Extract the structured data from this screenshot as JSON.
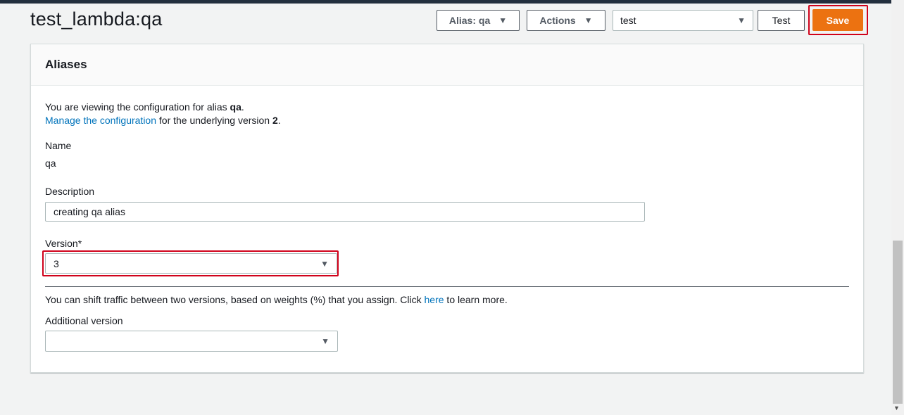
{
  "page": {
    "title": "test_lambda:qa"
  },
  "toolbar": {
    "alias_label": "Alias: qa",
    "actions_label": "Actions",
    "test_event_value": "test",
    "test_label": "Test",
    "save_label": "Save"
  },
  "aliases": {
    "title": "Aliases",
    "intro_prefix": "You are viewing the configuration for alias ",
    "intro_alias": "qa",
    "intro_suffix": ".",
    "manage_link": "Manage the configuration",
    "manage_mid": " for the underlying version ",
    "manage_version": "2",
    "manage_suffix": ".",
    "name_label": "Name",
    "name_value": "qa",
    "description_label": "Description",
    "description_value": "creating qa alias",
    "version_label": "Version*",
    "version_value": "3",
    "shift_prefix": "You can shift traffic between two versions, based on weights (%) that you assign. Click ",
    "shift_link": "here",
    "shift_suffix": " to learn more.",
    "additional_version_label": "Additional version",
    "additional_version_value": ""
  },
  "icons": {
    "dropdown": "caret-down-icon",
    "scroll_down": "scroll-down-arrow-icon"
  },
  "colors": {
    "primary_button": "#ec7211",
    "link": "#0073bb",
    "highlight": "#d0021b"
  }
}
